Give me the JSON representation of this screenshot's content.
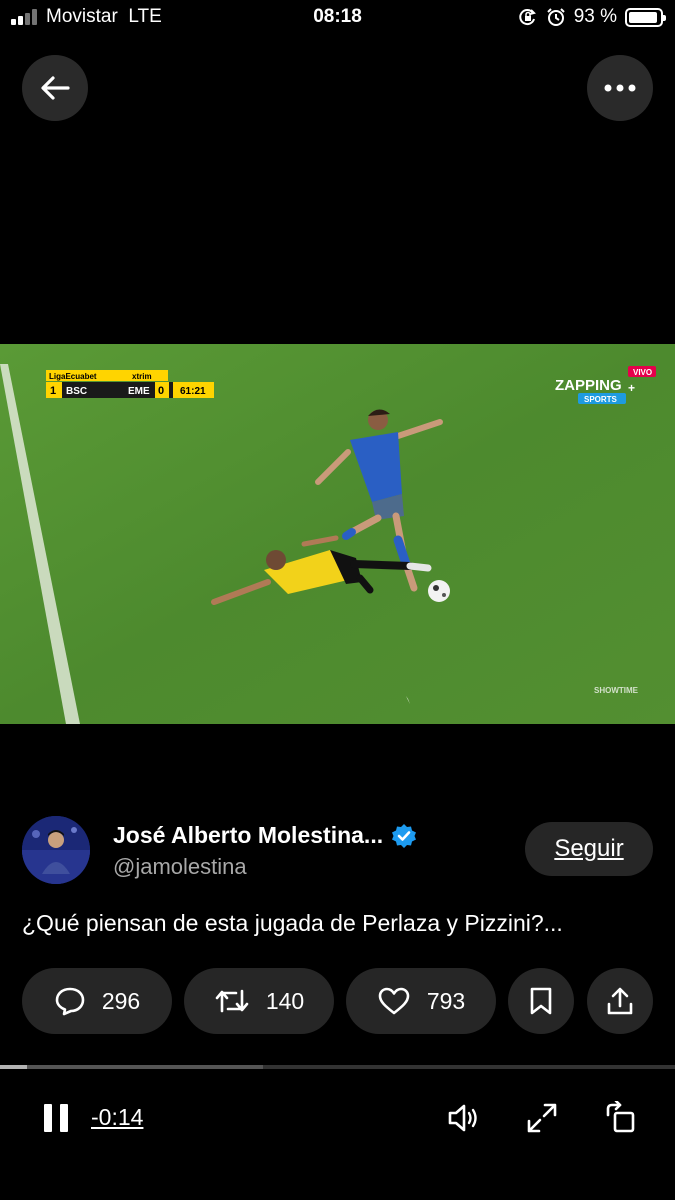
{
  "status_bar": {
    "carrier": "Movistar",
    "network": "LTE",
    "time": "08:18",
    "battery_percent": "93 %",
    "battery_level": 0.93,
    "icons": [
      "signal-icon",
      "orientation-lock-icon",
      "alarm-icon",
      "battery-icon"
    ]
  },
  "top_bar": {
    "icons": [
      "back-arrow-icon",
      "more-horizontal-icon"
    ]
  },
  "video": {
    "league": "LigaEcuabet",
    "sponsor": "xtrim",
    "home_team": "BSC",
    "home_score": "1",
    "away_team": "EME",
    "away_score": "0",
    "match_time": "61:21",
    "broadcaster": "ZAPPING",
    "broadcaster_sub": "SPORTS",
    "live_badge": "VIVO",
    "watermark": "SHOWTIME"
  },
  "tweet": {
    "author_name": "José Alberto Molestina...",
    "handle": "@jamolestina",
    "follow_label": "Seguir",
    "text": "¿Qué piensan de esta jugada de Perlaza y Pizzini?...",
    "verified_color": "#1d9bf0"
  },
  "actions": {
    "replies": "296",
    "retweets": "140",
    "likes": "793"
  },
  "player": {
    "time_remaining": "-0:14",
    "progress": 0.04,
    "buffered": 0.39,
    "icons": [
      "pause-icon",
      "volume-icon",
      "fullscreen-icon",
      "rotate-icon"
    ]
  }
}
